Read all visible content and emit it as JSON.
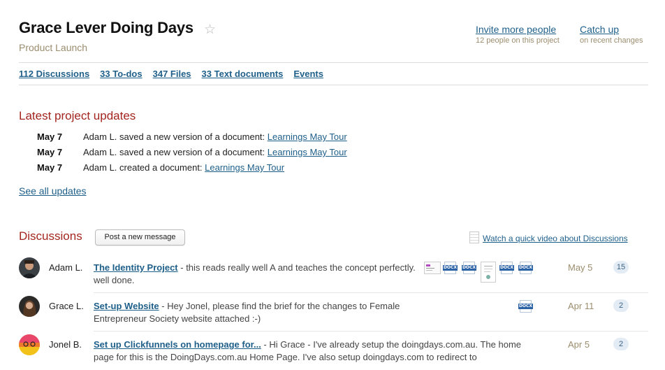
{
  "header": {
    "title": "Grace Lever Doing Days",
    "subtitle": "Product Launch",
    "invite_label": "Invite more people",
    "invite_sub": "12 people on this project",
    "catchup_label": "Catch up",
    "catchup_sub": "on recent changes"
  },
  "tabs": [
    {
      "label": "112 Discussions"
    },
    {
      "label": "33 To-dos"
    },
    {
      "label": "347 Files"
    },
    {
      "label": "33 Text documents"
    },
    {
      "label": "Events"
    }
  ],
  "updates": {
    "title": "Latest project updates",
    "items": [
      {
        "date": "May 7",
        "text": "Adam L. saved a new version of a document: ",
        "link": "Learnings May Tour"
      },
      {
        "date": "May 7",
        "text": "Adam L. saved a new version of a document: ",
        "link": "Learnings May Tour"
      },
      {
        "date": "May 7",
        "text": "Adam L. created a document: ",
        "link": "Learnings May Tour"
      }
    ],
    "see_all": "See all updates"
  },
  "discussions": {
    "title": "Discussions",
    "post_button": "Post a new message",
    "video_link": "Watch a quick video about Discussions",
    "items": [
      {
        "author": "Adam L.",
        "subject": "The Identity Project",
        "excerpt": " - this reads really well A and teaches the concept perfectly. well done.",
        "date": "May 5",
        "count": "15"
      },
      {
        "author": "Grace L.",
        "subject": "Set-up Website",
        "excerpt": " - Hey Jonel, please find the brief for the changes to Female Entrepreneur Society website attached :-)",
        "date": "Apr 11",
        "count": "2"
      },
      {
        "author": "Jonel B.",
        "subject": "Set up Clickfunnels on homepage for...",
        "excerpt": " - Hi Grace - I've already setup the doingdays.com.au. The home page for this is the DoingDays.com.au Home Page. I've also setup doingdays.com to redirect to",
        "date": "Apr 5",
        "count": "2"
      }
    ],
    "attachment_label": "DOCX"
  },
  "icons": {
    "star": "star-outline-icon",
    "film": "film-icon",
    "docx": "docx-file-icon"
  },
  "colors": {
    "link": "#1e5f8a",
    "section_title": "#a3251f",
    "muted": "#9b8d6e",
    "count_bg": "#e3ecf5"
  }
}
